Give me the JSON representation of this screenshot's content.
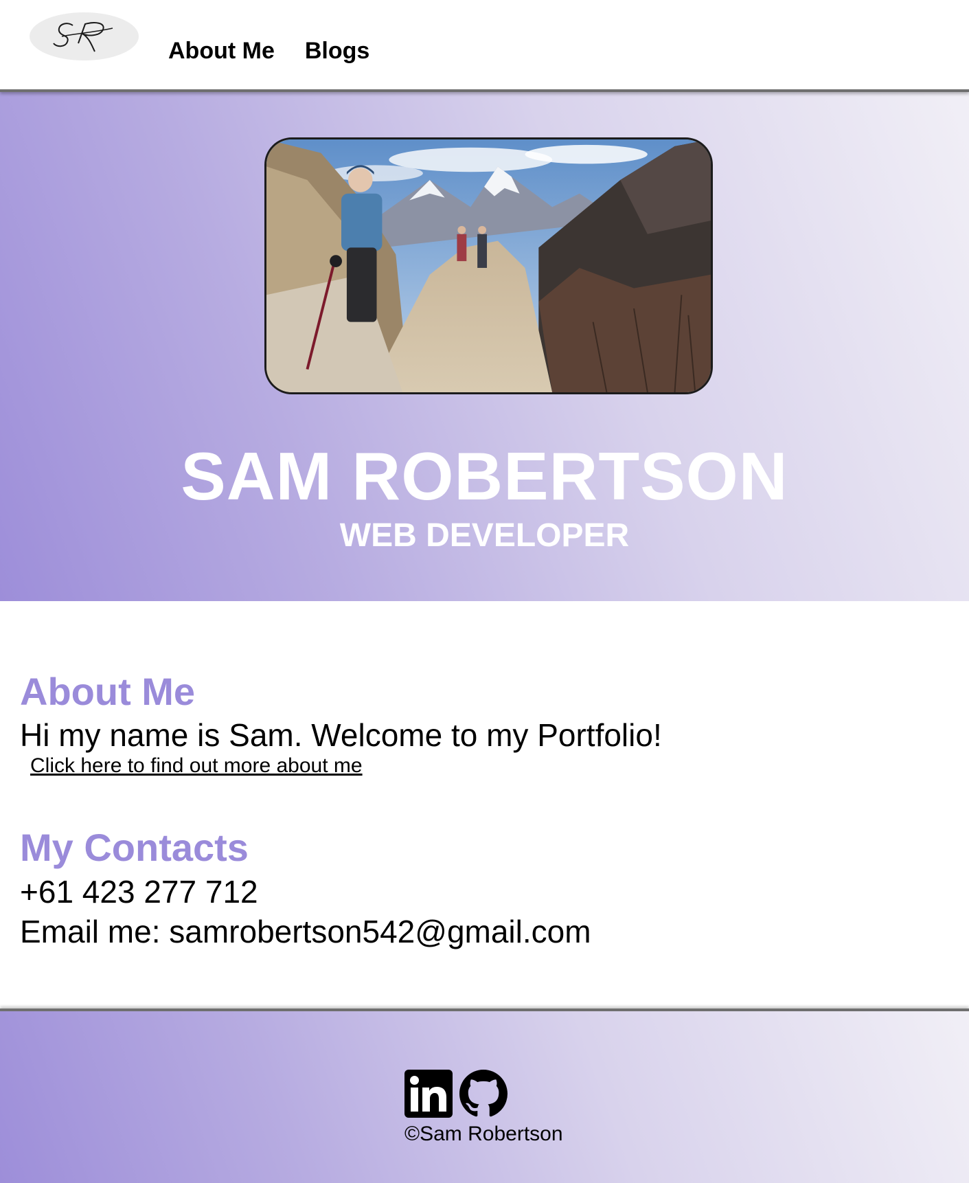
{
  "nav": {
    "logo_alt": "SR",
    "items": [
      {
        "label": "About Me"
      },
      {
        "label": "Blogs"
      }
    ]
  },
  "hero": {
    "name": "SAM ROBERTSON",
    "role": "WEB DEVELOPER"
  },
  "about": {
    "heading": "About Me",
    "intro": "Hi my name is Sam. Welcome to my Portfolio!",
    "link_label": "Click here to find out more about me"
  },
  "contacts": {
    "heading": "My Contacts",
    "phone": "+61 423 277 712",
    "email": "Email me: samrobertson542@gmail.com"
  },
  "footer": {
    "social": [
      {
        "icon": "linkedin-icon"
      },
      {
        "icon": "github-icon"
      }
    ],
    "copyright": "©Sam Robertson"
  },
  "colors": {
    "accent": "#9a8bda",
    "gradient_start": "#9d8ed9",
    "gradient_end": "#f1eff6"
  }
}
